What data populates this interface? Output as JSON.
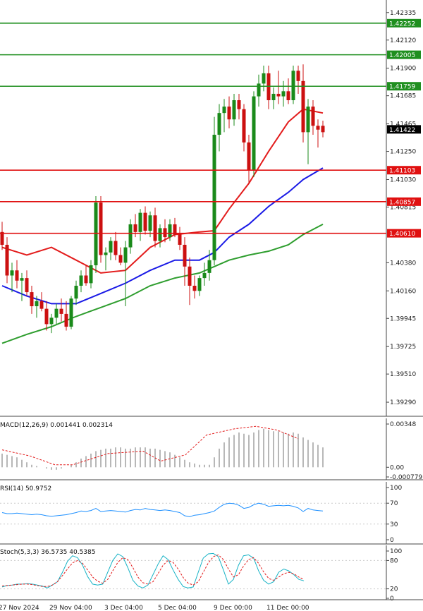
{
  "chart_data": {
    "type": "candlestick",
    "price_axis": {
      "range": [
        1.4918,
        1.42335
      ],
      "ticks": [
        "1.42335",
        "1.42120",
        "1.41900",
        "1.41685",
        "1.41465",
        "1.41250",
        "1.41030",
        "1.40815",
        "1.40380",
        "1.40160",
        "1.39945",
        "1.39725",
        "1.39510",
        "1.39290"
      ]
    },
    "x_labels": [
      "27 Nov 2024",
      "29 Nov 04:00",
      "3 Dec 04:00",
      "5 Dec 04:00",
      "9 Dec 00:00",
      "11 Dec 00:00"
    ],
    "current_price": {
      "value": 1.41422,
      "label": "1.41422"
    },
    "levels": [
      {
        "value": 1.42252,
        "label": "1.42252",
        "color": "#1f8f1f"
      },
      {
        "value": 1.42005,
        "label": "1.42005",
        "color": "#1f8f1f"
      },
      {
        "value": 1.41759,
        "label": "1.41759",
        "color": "#1f8f1f"
      },
      {
        "value": 1.41103,
        "label": "1.41103",
        "color": "#e01010"
      },
      {
        "value": 1.40857,
        "label": "1.40857",
        "color": "#e01010"
      },
      {
        "value": 1.4061,
        "label": "1.40610",
        "color": "#e01010"
      }
    ],
    "candles": [
      [
        1.4062,
        1.407,
        1.4048,
        1.4052
      ],
      [
        1.4052,
        1.4058,
        1.4022,
        1.4028
      ],
      [
        1.4028,
        1.4038,
        1.4015,
        1.4032
      ],
      [
        1.4032,
        1.404,
        1.4018,
        1.4024
      ],
      [
        1.4024,
        1.403,
        1.4008,
        1.4026
      ],
      [
        1.4026,
        1.4032,
        1.4012,
        1.4015
      ],
      [
        1.4015,
        1.402,
        1.3998,
        1.4004
      ],
      [
        1.4004,
        1.4012,
        1.3995,
        1.4008
      ],
      [
        1.4008,
        1.4015,
        1.4,
        1.4002
      ],
      [
        1.4002,
        1.4008,
        1.3985,
        1.399
      ],
      [
        1.399,
        1.3998,
        1.3983,
        1.3995
      ],
      [
        1.3995,
        1.4006,
        1.399,
        1.4002
      ],
      [
        1.4002,
        1.401,
        1.3992,
        1.3998
      ],
      [
        1.3998,
        1.4008,
        1.3985,
        1.3988
      ],
      [
        1.3988,
        1.4012,
        1.3986,
        1.401
      ],
      [
        1.401,
        1.4024,
        1.4005,
        1.402
      ],
      [
        1.402,
        1.4032,
        1.4015,
        1.4028
      ],
      [
        1.4028,
        1.4036,
        1.402,
        1.4022
      ],
      [
        1.4022,
        1.404,
        1.4018,
        1.4036
      ],
      [
        1.4036,
        1.409,
        1.403,
        1.4085
      ],
      [
        1.4085,
        1.409,
        1.4038,
        1.4044
      ],
      [
        1.4044,
        1.405,
        1.4032,
        1.4046
      ],
      [
        1.4046,
        1.4058,
        1.404,
        1.4055
      ],
      [
        1.4055,
        1.4062,
        1.404,
        1.4044
      ],
      [
        1.4044,
        1.405,
        1.4036,
        1.4038
      ],
      [
        1.4038,
        1.4055,
        1.4004,
        1.405
      ],
      [
        1.405,
        1.4072,
        1.4045,
        1.4068
      ],
      [
        1.4068,
        1.4076,
        1.4058,
        1.4062
      ],
      [
        1.4062,
        1.408,
        1.4055,
        1.4077
      ],
      [
        1.4077,
        1.4082,
        1.406,
        1.4063
      ],
      [
        1.4063,
        1.4078,
        1.4058,
        1.4075
      ],
      [
        1.4075,
        1.4081,
        1.405,
        1.4055
      ],
      [
        1.4055,
        1.4068,
        1.405,
        1.4065
      ],
      [
        1.4065,
        1.4072,
        1.4054,
        1.4058
      ],
      [
        1.4058,
        1.4072,
        1.4055,
        1.4068
      ],
      [
        1.4068,
        1.4073,
        1.4058,
        1.406
      ],
      [
        1.406,
        1.4066,
        1.4048,
        1.4052
      ],
      [
        1.4052,
        1.4058,
        1.402,
        1.4035
      ],
      [
        1.4035,
        1.4042,
        1.4005,
        1.402
      ],
      [
        1.402,
        1.4028,
        1.401,
        1.4016
      ],
      [
        1.4016,
        1.4028,
        1.4012,
        1.4026
      ],
      [
        1.4026,
        1.4038,
        1.402,
        1.403
      ],
      [
        1.403,
        1.4048,
        1.4024,
        1.404
      ],
      [
        1.404,
        1.4152,
        1.4036,
        1.4138
      ],
      [
        1.4138,
        1.4162,
        1.4125,
        1.4155
      ],
      [
        1.4155,
        1.4166,
        1.414,
        1.416
      ],
      [
        1.416,
        1.4168,
        1.4143,
        1.415
      ],
      [
        1.415,
        1.417,
        1.4145,
        1.4165
      ],
      [
        1.4165,
        1.417,
        1.415,
        1.4158
      ],
      [
        1.4158,
        1.4162,
        1.4125,
        1.4132
      ],
      [
        1.4132,
        1.4138,
        1.41,
        1.411
      ],
      [
        1.411,
        1.4172,
        1.4105,
        1.4168
      ],
      [
        1.4168,
        1.4185,
        1.416,
        1.4178
      ],
      [
        1.4178,
        1.4192,
        1.4172,
        1.4186
      ],
      [
        1.4186,
        1.4192,
        1.4158,
        1.4165
      ],
      [
        1.4165,
        1.4175,
        1.4158,
        1.417
      ],
      [
        1.417,
        1.4188,
        1.4162,
        1.4168
      ],
      [
        1.4168,
        1.418,
        1.416,
        1.4172
      ],
      [
        1.4172,
        1.4182,
        1.4162,
        1.4165
      ],
      [
        1.4165,
        1.4192,
        1.4162,
        1.4188
      ],
      [
        1.4188,
        1.4192,
        1.417,
        1.418
      ],
      [
        1.418,
        1.4193,
        1.4132,
        1.414
      ],
      [
        1.414,
        1.4166,
        1.4115,
        1.416
      ],
      [
        1.416,
        1.4165,
        1.4138,
        1.4145
      ],
      [
        1.4145,
        1.415,
        1.4128,
        1.4142
      ],
      [
        1.4145,
        1.4149,
        1.4136,
        1.414
      ]
    ],
    "ma_red": [
      [
        0,
        1.405
      ],
      [
        5,
        1.4044
      ],
      [
        10,
        1.405
      ],
      [
        15,
        1.404
      ],
      [
        20,
        1.403
      ],
      [
        25,
        1.4032
      ],
      [
        30,
        1.405
      ],
      [
        35,
        1.406
      ],
      [
        40,
        1.4062
      ],
      [
        43,
        1.4063
      ],
      [
        46,
        1.408
      ],
      [
        50,
        1.41
      ],
      [
        54,
        1.4125
      ],
      [
        58,
        1.4148
      ],
      [
        61,
        1.4158
      ],
      [
        65,
        1.4155
      ]
    ],
    "ma_blue": [
      [
        0,
        1.402
      ],
      [
        5,
        1.4012
      ],
      [
        10,
        1.4006
      ],
      [
        15,
        1.4006
      ],
      [
        20,
        1.4014
      ],
      [
        25,
        1.4022
      ],
      [
        30,
        1.4032
      ],
      [
        35,
        1.404
      ],
      [
        40,
        1.404
      ],
      [
        43,
        1.4046
      ],
      [
        46,
        1.4058
      ],
      [
        50,
        1.4068
      ],
      [
        54,
        1.4082
      ],
      [
        58,
        1.4093
      ],
      [
        61,
        1.4103
      ],
      [
        65,
        1.4112
      ]
    ],
    "ma_green": [
      [
        0,
        1.3975
      ],
      [
        5,
        1.3982
      ],
      [
        10,
        1.3988
      ],
      [
        15,
        1.3996
      ],
      [
        20,
        1.4003
      ],
      [
        25,
        1.401
      ],
      [
        30,
        1.402
      ],
      [
        35,
        1.4026
      ],
      [
        40,
        1.403
      ],
      [
        43,
        1.4035
      ],
      [
        46,
        1.404
      ],
      [
        50,
        1.4044
      ],
      [
        54,
        1.4047
      ],
      [
        58,
        1.4052
      ],
      [
        61,
        1.406
      ],
      [
        65,
        1.4068
      ]
    ],
    "macd": {
      "title": "MACD(12,26,9) 0.001441 0.002314",
      "axis_ticks": [
        "0.00348",
        "0.00",
        "-0.000779"
      ],
      "range": [
        -0.000779,
        0.00348
      ],
      "histogram": [
        0.0011,
        0.001,
        0.0009,
        0.0008,
        0.0006,
        0.0004,
        0.0002,
        0.0001,
        0.0,
        -0.0001,
        -0.0002,
        -0.0002,
        -0.0001,
        0.0,
        0.0002,
        0.0004,
        0.0007,
        0.0009,
        0.0011,
        0.0013,
        0.0014,
        0.0015,
        0.0015,
        0.0016,
        0.0016,
        0.0015,
        0.0015,
        0.0016,
        0.0016,
        0.0016,
        0.0015,
        0.0015,
        0.0014,
        0.0013,
        0.0012,
        0.001,
        0.0008,
        0.0006,
        0.0004,
        0.0003,
        0.0002,
        0.0002,
        0.0002,
        0.0008,
        0.0015,
        0.002,
        0.0024,
        0.0026,
        0.0028,
        0.0027,
        0.0026,
        0.0028,
        0.003,
        0.0031,
        0.003,
        0.0029,
        0.0029,
        0.0028,
        0.0027,
        0.0028,
        0.0027,
        0.0024,
        0.0022,
        0.002,
        0.0018,
        0.0016
      ],
      "signal": [
        [
          0,
          0.0014
        ],
        [
          8,
          0.0009
        ],
        [
          15,
          0.0002
        ],
        [
          20,
          0.0002
        ],
        [
          30,
          0.0011
        ],
        [
          40,
          0.0013
        ],
        [
          45,
          0.0005
        ],
        [
          52,
          0.001
        ],
        [
          58,
          0.0026
        ],
        [
          66,
          0.0031
        ],
        [
          72,
          0.0033
        ],
        [
          78,
          0.003
        ],
        [
          84,
          0.0023
        ]
      ]
    },
    "rsi": {
      "title": "RSI(14) 50.9752",
      "axis_ticks": [
        "100",
        "70",
        "30",
        "0"
      ],
      "range": [
        0,
        100
      ],
      "values": [
        52,
        50,
        50,
        51,
        50,
        49,
        48,
        49,
        48,
        46,
        45,
        46,
        47,
        48,
        50,
        52,
        55,
        54,
        56,
        60,
        54,
        55,
        56,
        55,
        54,
        53,
        56,
        58,
        57,
        60,
        58,
        57,
        56,
        57,
        56,
        54,
        52,
        46,
        44,
        47,
        48,
        50,
        52,
        55,
        62,
        68,
        70,
        69,
        66,
        60,
        62,
        67,
        70,
        68,
        64,
        65,
        66,
        65,
        66,
        64,
        61,
        54,
        60,
        57,
        56,
        55
      ]
    },
    "stoch": {
      "title": "Stoch(5,3,3) 36.5735 40.5385",
      "axis_ticks": [
        "100",
        "80",
        "20",
        "0"
      ],
      "range": [
        0,
        100
      ],
      "k": [
        24,
        27,
        28,
        30,
        30,
        31,
        30,
        28,
        26,
        22,
        28,
        35,
        55,
        78,
        90,
        86,
        70,
        46,
        30,
        28,
        30,
        55,
        80,
        94,
        88,
        65,
        38,
        26,
        22,
        28,
        50,
        72,
        90,
        82,
        60,
        40,
        25,
        22,
        24,
        55,
        85,
        94,
        95,
        88,
        60,
        30,
        40,
        70,
        90,
        92,
        85,
        58,
        38,
        30,
        35,
        55,
        62,
        58,
        50,
        40,
        37
      ],
      "d": [
        26,
        27,
        28,
        29,
        30,
        30,
        29,
        27,
        25,
        25,
        28,
        35,
        48,
        62,
        75,
        80,
        74,
        60,
        45,
        36,
        32,
        40,
        58,
        76,
        86,
        82,
        65,
        45,
        33,
        30,
        35,
        52,
        70,
        80,
        76,
        62,
        44,
        32,
        28,
        35,
        55,
        75,
        88,
        92,
        82,
        62,
        45,
        50,
        68,
        82,
        86,
        74,
        56,
        42,
        38,
        45,
        52,
        55,
        52,
        45,
        40
      ]
    }
  }
}
